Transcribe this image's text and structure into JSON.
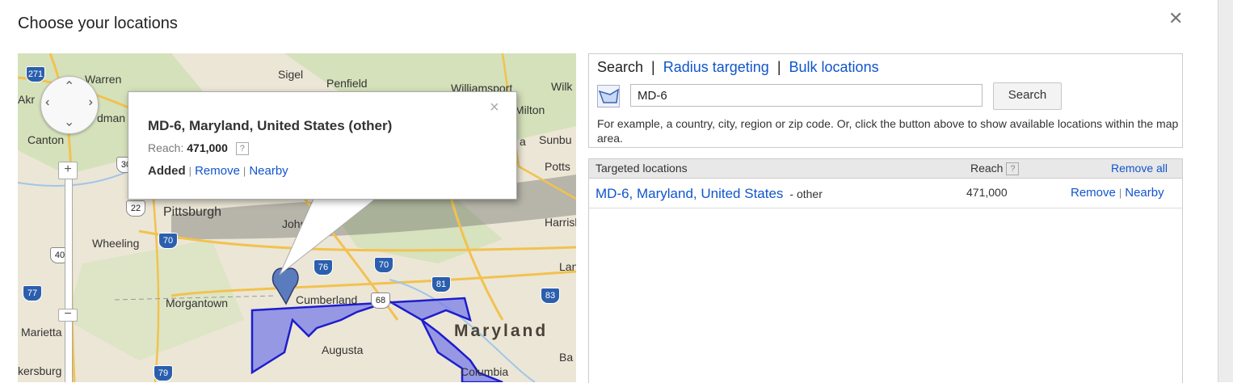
{
  "dialog": {
    "title": "Choose your locations",
    "close_glyph": "✕"
  },
  "map": {
    "labels": {
      "warren": "Warren",
      "sigel": "Sigel",
      "penfield": "Penfield",
      "williamsport": "Williamsport",
      "wilk": "Wilk",
      "milton": "Milton",
      "sunbury": "Sunbu",
      "potts": "Potts",
      "akron": "Akr",
      "canton": "Canton",
      "dman": "dman",
      "pittsburgh": "Pittsburgh",
      "johnstown": "Johns",
      "harrisburg": "Harrisb",
      "wheeling": "Wheeling",
      "morgantown": "Morgantown",
      "cumberland": "Cumberland",
      "maryland": "Maryland",
      "augusta": "Augusta",
      "marietta": "Marietta",
      "parkersburg": "kersburg",
      "columbia": "Columbia",
      "lan": "Lan",
      "ba": "Ba",
      "a": "a"
    },
    "shields": {
      "i271": "271",
      "i22": "22",
      "i70a": "70",
      "i76": "76",
      "i70b": "70",
      "i81": "81",
      "i68": "68",
      "i83": "83",
      "i40": "40",
      "i77": "77",
      "i79": "79",
      "i30": "30"
    },
    "zoom_in": "+",
    "zoom_out": "−",
    "popup": {
      "title": "MD-6, Maryland, United States (other)",
      "reach_label": "Reach:",
      "reach_value": "471,000",
      "help": "?",
      "added": "Added",
      "remove": "Remove",
      "nearby": "Nearby",
      "separator": "|",
      "close": "×"
    }
  },
  "search_panel": {
    "tabs": {
      "search": "Search",
      "radius": "Radius targeting",
      "bulk": "Bulk locations",
      "separator": "|"
    },
    "input_value": "MD-6",
    "search_button": "Search",
    "hint": "For example, a country, city, region or zip code. Or, click the button above to show available locations within the map area."
  },
  "targeted": {
    "header": {
      "locations": "Targeted locations",
      "reach": "Reach",
      "help": "?",
      "remove_all": "Remove all"
    },
    "rows": [
      {
        "name": "MD-6, Maryland, United States",
        "qualifier": "- other",
        "reach": "471,000",
        "remove": "Remove",
        "nearby": "Nearby",
        "separator": "|"
      }
    ]
  },
  "colors": {
    "link": "#1155cc",
    "polygon_fill": "#7a7ee8",
    "polygon_stroke": "#1d1dcc"
  }
}
